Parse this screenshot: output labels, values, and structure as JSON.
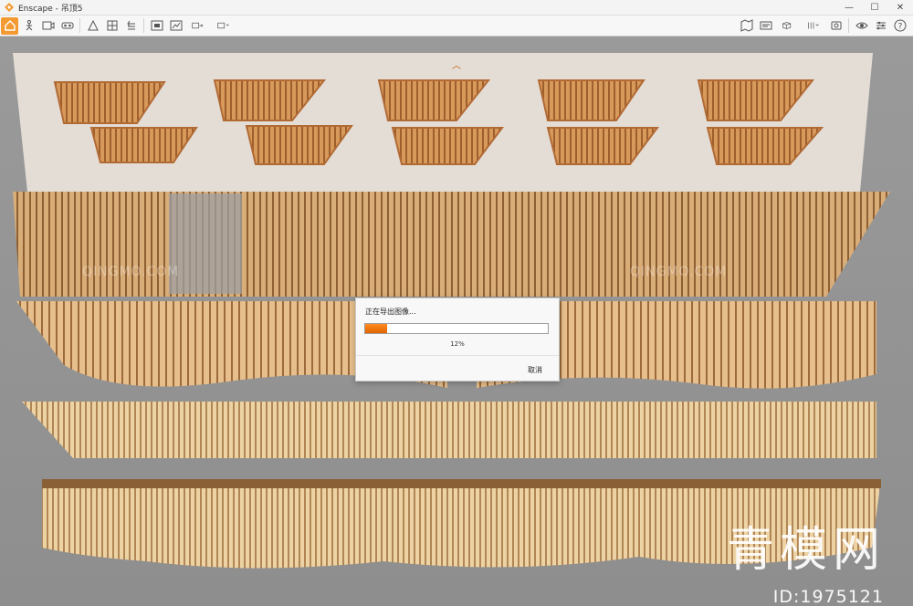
{
  "window": {
    "title": "Enscape - 吊顶5",
    "controls": {
      "minimize": "—",
      "maximize": "☐",
      "close": "✕"
    }
  },
  "toolbar": {
    "left": [
      {
        "name": "home-button",
        "icon": "home-icon",
        "active": true
      },
      {
        "name": "walk-mode-button",
        "icon": "walk-icon"
      },
      {
        "name": "video-editor-button",
        "icon": "video-icon"
      },
      {
        "name": "vr-button",
        "icon": "vr-headset-icon"
      },
      {
        "name": "asset-library-button",
        "icon": "asset-icon"
      },
      {
        "name": "materials-button",
        "icon": "material-icon"
      },
      {
        "name": "sync-button",
        "icon": "sync-icon"
      },
      {
        "name": "screenshot-button",
        "icon": "screenshot-icon"
      },
      {
        "name": "render-button",
        "icon": "render-icon"
      },
      {
        "name": "export-button",
        "icon": "export-icon"
      },
      {
        "name": "upload-button",
        "icon": "upload-icon"
      }
    ],
    "right": [
      {
        "name": "views-button",
        "icon": "map-icon"
      },
      {
        "name": "panorama-button",
        "icon": "panorama-icon"
      },
      {
        "name": "box-button",
        "icon": "box-icon"
      },
      {
        "name": "settings-dropdown-button",
        "icon": "settings-icon"
      },
      {
        "name": "capture-button",
        "icon": "capture-icon"
      },
      {
        "name": "eye-button",
        "icon": "eye-icon"
      },
      {
        "name": "visual-settings-button",
        "icon": "sliders-icon"
      },
      {
        "name": "help-button",
        "icon": "help-icon"
      }
    ]
  },
  "dialog": {
    "title": "正在导出图像...",
    "progress_percent": 12,
    "progress_label": "12%",
    "cancel_label": "取消"
  },
  "watermark": {
    "text": "QINGMO.COM",
    "brand": "青模网",
    "id_text": "ID:1975121"
  },
  "colors": {
    "accent": "#f39a33",
    "progress": "#ff7a10"
  }
}
